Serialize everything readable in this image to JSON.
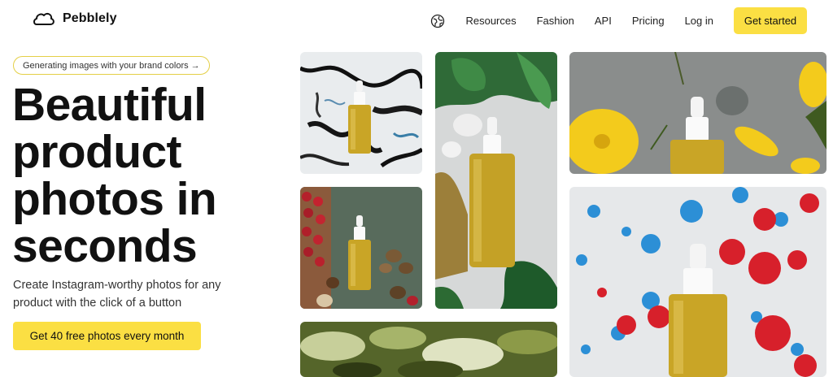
{
  "brand": {
    "name": "Pebblely",
    "logo_icon": "pebble-icon"
  },
  "nav": {
    "language_icon": "globe-icon",
    "links": [
      "Resources",
      "Fashion",
      "API",
      "Pricing",
      "Log in"
    ],
    "cta": "Get started"
  },
  "hero": {
    "badge": "Generating images with your brand colors →",
    "headline_lines": [
      "Beautiful",
      "product",
      "photos in",
      "seconds"
    ],
    "subtext_lines": [
      "Create Instagram-worthy photos for any",
      "product with the click of a button"
    ],
    "cta": "Get 40 free photos every month"
  },
  "gallery": [
    {
      "name": "serum-on-black-ink-marble"
    },
    {
      "name": "serum-with-berries-and-nuts"
    },
    {
      "name": "leaves-closeup"
    },
    {
      "name": "serum-on-water-with-monstera"
    },
    {
      "name": "serum-with-yellow-flowers"
    },
    {
      "name": "serum-with-blue-red-paint-splatter"
    }
  ],
  "colors": {
    "accent": "#fbdf43",
    "badge_border": "#e4cf46"
  }
}
